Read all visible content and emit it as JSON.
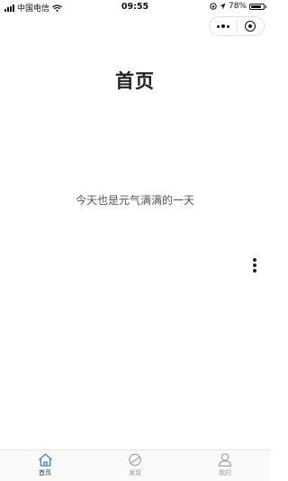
{
  "status_bar": {
    "carrier": "中国电信",
    "time": "09:55",
    "battery": "78%",
    "battery_level": 0.78
  },
  "capsule": {
    "more_icon": "more-dots-icon",
    "close_icon": "target-circle-icon"
  },
  "page": {
    "title": "首页",
    "welcome": "今天也是元气满满的一天",
    "more_icon": "vertical-dots-icon"
  },
  "tab_bar": {
    "active_color": "#2a8ad6",
    "inactive_color": "#999999",
    "tabs": [
      {
        "label": "首页",
        "icon": "home-icon",
        "active": true
      },
      {
        "label": "发现",
        "icon": "planet-icon",
        "active": false
      },
      {
        "label": "我的",
        "icon": "user-icon",
        "active": false
      }
    ]
  }
}
